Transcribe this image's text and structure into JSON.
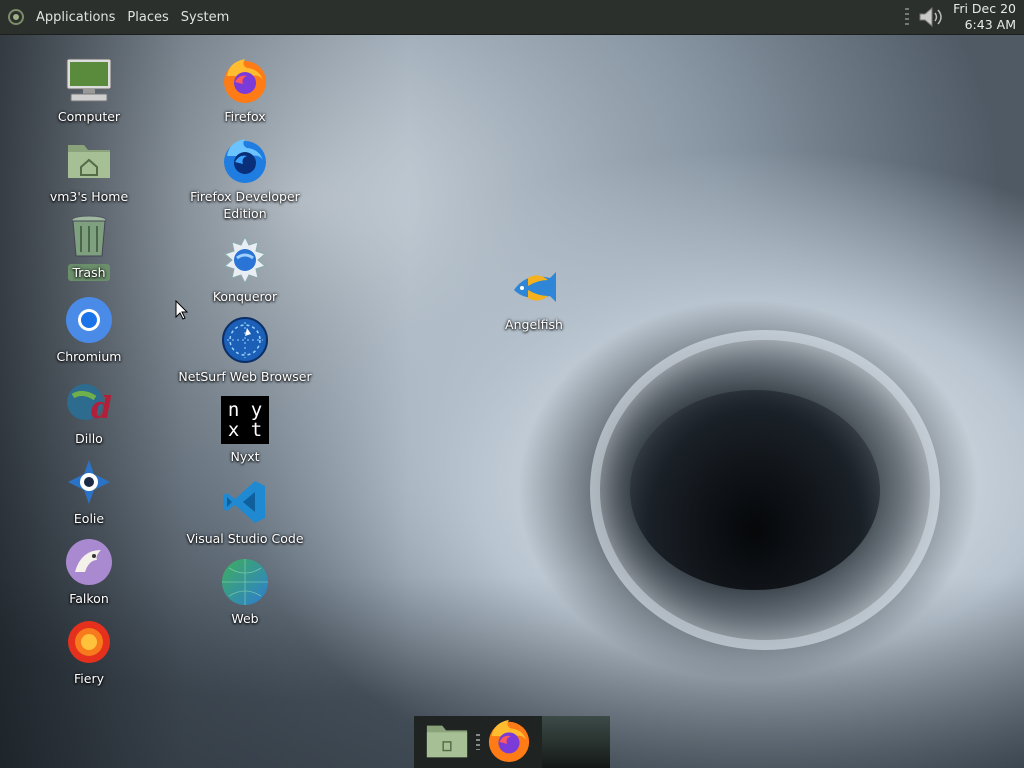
{
  "panel": {
    "menus": [
      "Applications",
      "Places",
      "System"
    ],
    "clock_date": "Fri Dec 20",
    "clock_time": "6:43 AM"
  },
  "desktop_icons": [
    {
      "label": "Computer",
      "icon": "computer-icon"
    },
    {
      "label": "vm3's Home",
      "icon": "home-folder-icon"
    },
    {
      "label": "Trash",
      "icon": "trash-icon"
    },
    {
      "label": "Chromium",
      "icon": "chromium-icon"
    },
    {
      "label": "Dillo",
      "icon": "dillo-icon"
    },
    {
      "label": "Eolie",
      "icon": "eolie-icon"
    },
    {
      "label": "Falkon",
      "icon": "falkon-icon"
    },
    {
      "label": "Fiery",
      "icon": "fiery-icon"
    },
    {
      "label": "Firefox",
      "icon": "firefox-icon"
    },
    {
      "label": "Firefox Developer Edition",
      "icon": "firefox-developer-icon"
    },
    {
      "label": "Konqueror",
      "icon": "konqueror-icon"
    },
    {
      "label": "NetSurf Web Browser",
      "icon": "netsurf-icon"
    },
    {
      "label": "Nyxt",
      "icon": "nyxt-icon",
      "glyph_top": "n y",
      "glyph_bottom": "x t"
    },
    {
      "label": "Visual Studio Code",
      "icon": "vscode-icon"
    },
    {
      "label": "Web",
      "icon": "web-icon"
    },
    {
      "label": "Angelfish",
      "icon": "angelfish-icon"
    }
  ],
  "dock": {
    "items": [
      "file-manager-icon",
      "firefox-icon"
    ]
  },
  "colors": {
    "panel_bg": "#2c302c",
    "trash_highlight": "#6b8e6b"
  }
}
